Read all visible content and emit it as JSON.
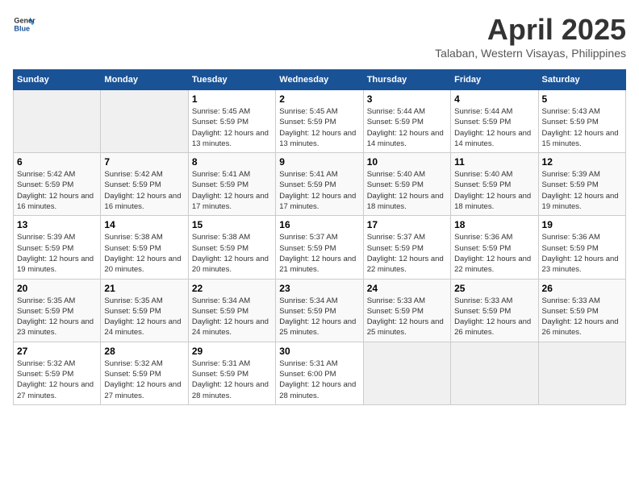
{
  "header": {
    "logo_general": "General",
    "logo_blue": "Blue",
    "month_title": "April 2025",
    "location": "Talaban, Western Visayas, Philippines"
  },
  "weekdays": [
    "Sunday",
    "Monday",
    "Tuesday",
    "Wednesday",
    "Thursday",
    "Friday",
    "Saturday"
  ],
  "weeks": [
    [
      {
        "day": "",
        "sunrise": "",
        "sunset": "",
        "daylight": ""
      },
      {
        "day": "",
        "sunrise": "",
        "sunset": "",
        "daylight": ""
      },
      {
        "day": "1",
        "sunrise": "Sunrise: 5:45 AM",
        "sunset": "Sunset: 5:59 PM",
        "daylight": "Daylight: 12 hours and 13 minutes."
      },
      {
        "day": "2",
        "sunrise": "Sunrise: 5:45 AM",
        "sunset": "Sunset: 5:59 PM",
        "daylight": "Daylight: 12 hours and 13 minutes."
      },
      {
        "day": "3",
        "sunrise": "Sunrise: 5:44 AM",
        "sunset": "Sunset: 5:59 PM",
        "daylight": "Daylight: 12 hours and 14 minutes."
      },
      {
        "day": "4",
        "sunrise": "Sunrise: 5:44 AM",
        "sunset": "Sunset: 5:59 PM",
        "daylight": "Daylight: 12 hours and 14 minutes."
      },
      {
        "day": "5",
        "sunrise": "Sunrise: 5:43 AM",
        "sunset": "Sunset: 5:59 PM",
        "daylight": "Daylight: 12 hours and 15 minutes."
      }
    ],
    [
      {
        "day": "6",
        "sunrise": "Sunrise: 5:42 AM",
        "sunset": "Sunset: 5:59 PM",
        "daylight": "Daylight: 12 hours and 16 minutes."
      },
      {
        "day": "7",
        "sunrise": "Sunrise: 5:42 AM",
        "sunset": "Sunset: 5:59 PM",
        "daylight": "Daylight: 12 hours and 16 minutes."
      },
      {
        "day": "8",
        "sunrise": "Sunrise: 5:41 AM",
        "sunset": "Sunset: 5:59 PM",
        "daylight": "Daylight: 12 hours and 17 minutes."
      },
      {
        "day": "9",
        "sunrise": "Sunrise: 5:41 AM",
        "sunset": "Sunset: 5:59 PM",
        "daylight": "Daylight: 12 hours and 17 minutes."
      },
      {
        "day": "10",
        "sunrise": "Sunrise: 5:40 AM",
        "sunset": "Sunset: 5:59 PM",
        "daylight": "Daylight: 12 hours and 18 minutes."
      },
      {
        "day": "11",
        "sunrise": "Sunrise: 5:40 AM",
        "sunset": "Sunset: 5:59 PM",
        "daylight": "Daylight: 12 hours and 18 minutes."
      },
      {
        "day": "12",
        "sunrise": "Sunrise: 5:39 AM",
        "sunset": "Sunset: 5:59 PM",
        "daylight": "Daylight: 12 hours and 19 minutes."
      }
    ],
    [
      {
        "day": "13",
        "sunrise": "Sunrise: 5:39 AM",
        "sunset": "Sunset: 5:59 PM",
        "daylight": "Daylight: 12 hours and 19 minutes."
      },
      {
        "day": "14",
        "sunrise": "Sunrise: 5:38 AM",
        "sunset": "Sunset: 5:59 PM",
        "daylight": "Daylight: 12 hours and 20 minutes."
      },
      {
        "day": "15",
        "sunrise": "Sunrise: 5:38 AM",
        "sunset": "Sunset: 5:59 PM",
        "daylight": "Daylight: 12 hours and 20 minutes."
      },
      {
        "day": "16",
        "sunrise": "Sunrise: 5:37 AM",
        "sunset": "Sunset: 5:59 PM",
        "daylight": "Daylight: 12 hours and 21 minutes."
      },
      {
        "day": "17",
        "sunrise": "Sunrise: 5:37 AM",
        "sunset": "Sunset: 5:59 PM",
        "daylight": "Daylight: 12 hours and 22 minutes."
      },
      {
        "day": "18",
        "sunrise": "Sunrise: 5:36 AM",
        "sunset": "Sunset: 5:59 PM",
        "daylight": "Daylight: 12 hours and 22 minutes."
      },
      {
        "day": "19",
        "sunrise": "Sunrise: 5:36 AM",
        "sunset": "Sunset: 5:59 PM",
        "daylight": "Daylight: 12 hours and 23 minutes."
      }
    ],
    [
      {
        "day": "20",
        "sunrise": "Sunrise: 5:35 AM",
        "sunset": "Sunset: 5:59 PM",
        "daylight": "Daylight: 12 hours and 23 minutes."
      },
      {
        "day": "21",
        "sunrise": "Sunrise: 5:35 AM",
        "sunset": "Sunset: 5:59 PM",
        "daylight": "Daylight: 12 hours and 24 minutes."
      },
      {
        "day": "22",
        "sunrise": "Sunrise: 5:34 AM",
        "sunset": "Sunset: 5:59 PM",
        "daylight": "Daylight: 12 hours and 24 minutes."
      },
      {
        "day": "23",
        "sunrise": "Sunrise: 5:34 AM",
        "sunset": "Sunset: 5:59 PM",
        "daylight": "Daylight: 12 hours and 25 minutes."
      },
      {
        "day": "24",
        "sunrise": "Sunrise: 5:33 AM",
        "sunset": "Sunset: 5:59 PM",
        "daylight": "Daylight: 12 hours and 25 minutes."
      },
      {
        "day": "25",
        "sunrise": "Sunrise: 5:33 AM",
        "sunset": "Sunset: 5:59 PM",
        "daylight": "Daylight: 12 hours and 26 minutes."
      },
      {
        "day": "26",
        "sunrise": "Sunrise: 5:33 AM",
        "sunset": "Sunset: 5:59 PM",
        "daylight": "Daylight: 12 hours and 26 minutes."
      }
    ],
    [
      {
        "day": "27",
        "sunrise": "Sunrise: 5:32 AM",
        "sunset": "Sunset: 5:59 PM",
        "daylight": "Daylight: 12 hours and 27 minutes."
      },
      {
        "day": "28",
        "sunrise": "Sunrise: 5:32 AM",
        "sunset": "Sunset: 5:59 PM",
        "daylight": "Daylight: 12 hours and 27 minutes."
      },
      {
        "day": "29",
        "sunrise": "Sunrise: 5:31 AM",
        "sunset": "Sunset: 5:59 PM",
        "daylight": "Daylight: 12 hours and 28 minutes."
      },
      {
        "day": "30",
        "sunrise": "Sunrise: 5:31 AM",
        "sunset": "Sunset: 6:00 PM",
        "daylight": "Daylight: 12 hours and 28 minutes."
      },
      {
        "day": "",
        "sunrise": "",
        "sunset": "",
        "daylight": ""
      },
      {
        "day": "",
        "sunrise": "",
        "sunset": "",
        "daylight": ""
      },
      {
        "day": "",
        "sunrise": "",
        "sunset": "",
        "daylight": ""
      }
    ]
  ]
}
